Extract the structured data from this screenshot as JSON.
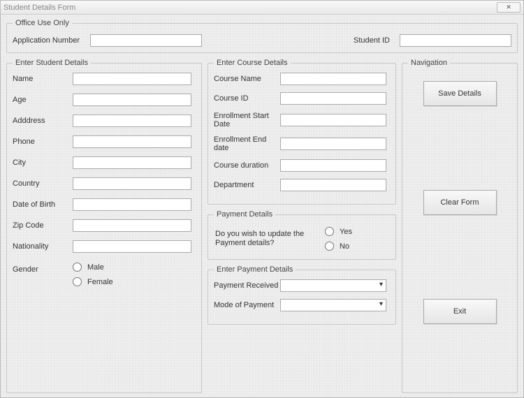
{
  "window": {
    "title": "Student Details Form"
  },
  "office": {
    "legend": "Office Use Only",
    "appnum_label": "Application Number",
    "appnum_value": "",
    "sid_label": "Student ID",
    "sid_value": ""
  },
  "student": {
    "legend": "Enter Student Details",
    "name_label": "Name",
    "name_value": "",
    "age_label": "Age",
    "age_value": "",
    "address_label": "Adddress",
    "address_value": "",
    "phone_label": "Phone",
    "phone_value": "",
    "city_label": "City",
    "city_value": "",
    "country_label": "Country",
    "country_value": "",
    "dob_label": "Date of Birth",
    "dob_value": "",
    "zip_label": "Zip Code",
    "zip_value": "",
    "nat_label": "Nationality",
    "nat_value": "",
    "gender_label": "Gender",
    "gender_male": "Male",
    "gender_female": "Female"
  },
  "course": {
    "legend": "Enter Course Details",
    "cname_label": "Course Name",
    "cname_value": "",
    "cid_label": "Course ID",
    "cid_value": "",
    "estart_label": "Enrollment Start Date",
    "estart_value": "",
    "eend_label": "Enrollment End date",
    "eend_value": "",
    "cdur_label": "Course duration",
    "cdur_value": "",
    "dept_label": "Department",
    "dept_value": ""
  },
  "payq": {
    "legend": "Payment Details",
    "question": "Do you wish to update the Payment details?",
    "yes": "Yes",
    "no": "No"
  },
  "payd": {
    "legend": "Enter Payment Details",
    "received_label": "Payment Received",
    "received_value": "",
    "mode_label": "Mode of Payment",
    "mode_value": ""
  },
  "nav": {
    "legend": "Navigation",
    "save": "Save Details",
    "clear": "Clear Form",
    "exit": "Exit"
  }
}
